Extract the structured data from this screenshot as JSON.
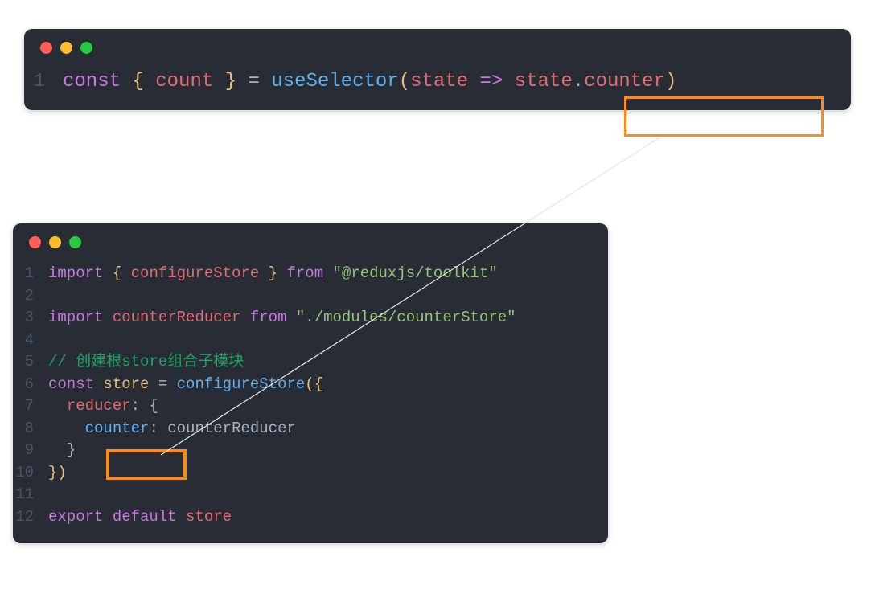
{
  "top": {
    "line1": {
      "lineno": "1",
      "kw_const": "const",
      "brace_l": " { ",
      "count": "count",
      "brace_r": " } ",
      "eq": "= ",
      "fn": "useSelector",
      "paren_l": "(",
      "param": "state",
      "arrow": " => ",
      "obj": "state",
      "dot": ".",
      "prop": "counter",
      "paren_r": ")"
    }
  },
  "bottom": {
    "l1": {
      "n": "1",
      "kw": "import",
      "b1": " { ",
      "id": "configureStore",
      "b2": " } ",
      "from": "from",
      "sp": " ",
      "str": "\"@reduxjs/toolkit\""
    },
    "l2": {
      "n": "2"
    },
    "l3": {
      "n": "3",
      "kw": "import",
      "sp": " ",
      "id": "counterReducer",
      "sp2": " ",
      "from": "from",
      "sp3": " ",
      "str": "\"./modules/counterStore\""
    },
    "l4": {
      "n": "4"
    },
    "l5": {
      "n": "5",
      "comment": "// 创建根store组合子模块"
    },
    "l6": {
      "n": "6",
      "kw": "const",
      "sp": " ",
      "id": "store",
      "eq": " = ",
      "fn": "configureStore",
      "paren": "({"
    },
    "l7": {
      "n": "7",
      "indent": "  ",
      "prop": "reducer",
      "colon": ": {"
    },
    "l8": {
      "n": "8",
      "indent": "    ",
      "prop": "counter",
      "colon": ": ",
      "val": "counterReducer"
    },
    "l9": {
      "n": "9",
      "indent": "  ",
      "brace": "}"
    },
    "l10": {
      "n": "10",
      "brace": "})"
    },
    "l11": {
      "n": "11"
    },
    "l12": {
      "n": "12",
      "kw1": "export",
      "kw2": " default ",
      "id": "store"
    }
  }
}
